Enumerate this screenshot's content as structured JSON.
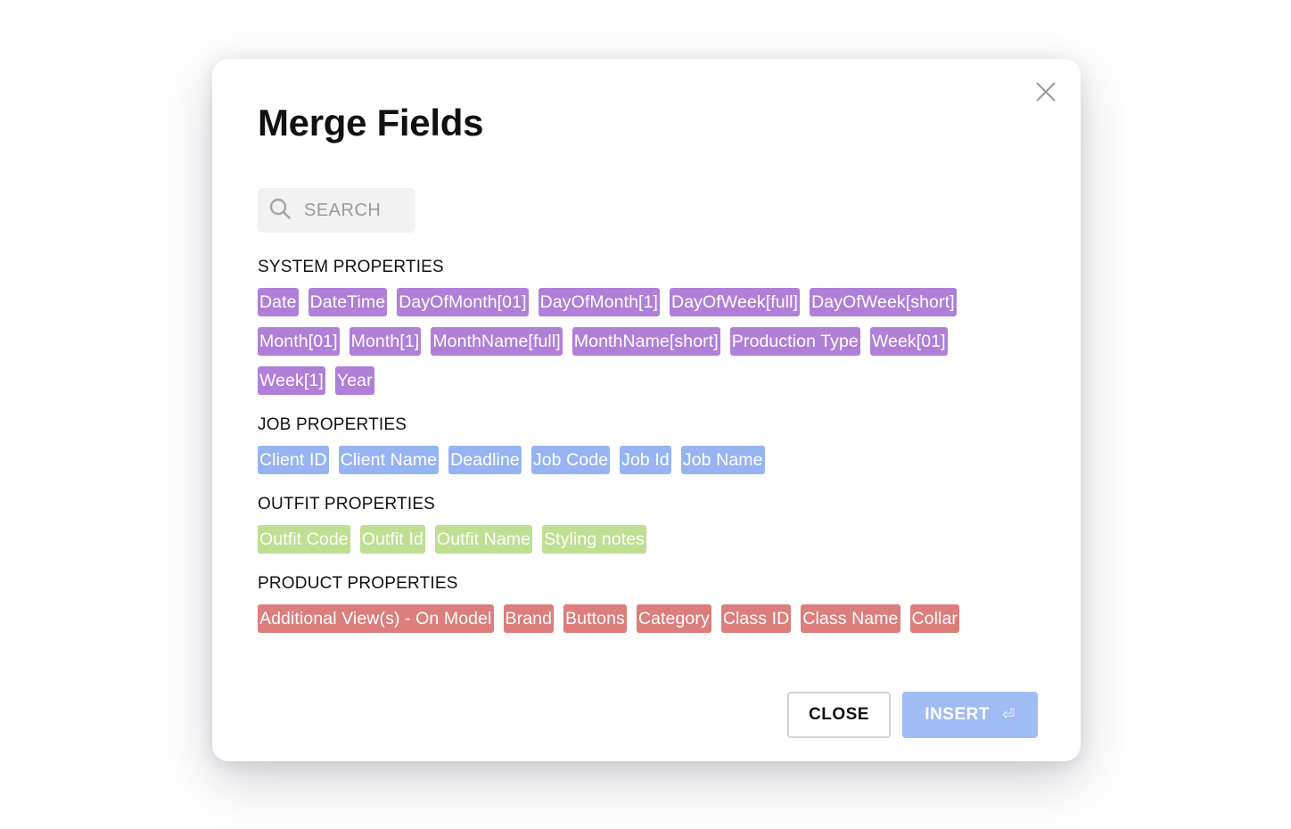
{
  "dialog": {
    "title": "Merge Fields",
    "close_icon": "close-x-icon",
    "search": {
      "placeholder": "SEARCH",
      "value": "",
      "icon": "search-icon"
    },
    "sections": [
      {
        "title": "SYSTEM PROPERTIES",
        "kind": "system",
        "color": "#b07fd8",
        "fields": [
          "Date",
          "DateTime",
          "DayOfMonth[01]",
          "DayOfMonth[1]",
          "DayOfWeek[full]",
          "DayOfWeek[short]",
          "Month[01]",
          "Month[1]",
          "MonthName[full]",
          "MonthName[short]",
          "Production Type",
          "Week[01]",
          "Week[1]",
          "Year"
        ]
      },
      {
        "title": "JOB PROPERTIES",
        "kind": "job",
        "color": "#96b4f2",
        "fields": [
          "Client ID",
          "Client Name",
          "Deadline",
          "Job Code",
          "Job Id",
          "Job Name"
        ]
      },
      {
        "title": "OUTFIT PROPERTIES",
        "kind": "outfit",
        "color": "#bfdf92",
        "fields": [
          "Outfit Code",
          "Outfit Id",
          "Outfit Name",
          "Styling notes"
        ]
      },
      {
        "title": "PRODUCT PROPERTIES",
        "kind": "product",
        "color": "#db7e7c",
        "fields": [
          "Additional View(s) - On Model",
          "Brand",
          "Buttons",
          "Category",
          "Class ID",
          "Class Name",
          "Collar"
        ]
      }
    ],
    "buttons": {
      "close_label": "CLOSE",
      "insert_label": "INSERT",
      "insert_icon": "enter-key-icon",
      "insert_icon_glyph": "⏎"
    }
  }
}
